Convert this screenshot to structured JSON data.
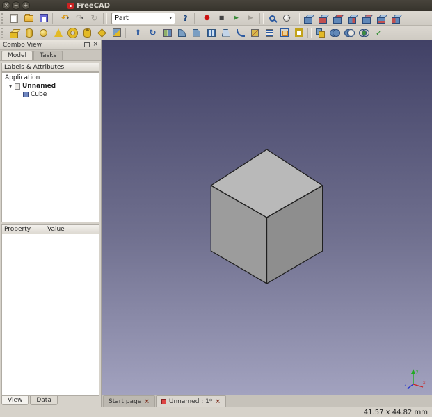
{
  "window": {
    "title": "FreeCAD",
    "buttons": {
      "close": "×",
      "minimize": "−",
      "maximize": "+"
    }
  },
  "ui_glyphs": {
    "caret": "▾",
    "expander": "▼",
    "close": "×"
  },
  "toolbars": {
    "workbench_selector": {
      "value": "Part"
    },
    "file_icons": [
      {
        "name": "new-document-icon",
        "cls": "i-doc"
      },
      {
        "name": "open-document-icon",
        "cls": "i-folder"
      },
      {
        "name": "save-document-icon",
        "cls": "i-save"
      },
      {
        "type": "sep"
      },
      {
        "name": "undo-icon",
        "cls": "i-undo",
        "glyph": "↶",
        "caret": true
      },
      {
        "name": "redo-icon",
        "cls": "i-redo",
        "glyph": "↷",
        "caret": true
      },
      {
        "name": "refresh-icon",
        "cls": "i-refresh",
        "glyph": "↻"
      },
      {
        "type": "sep"
      }
    ],
    "view_icons": [
      {
        "name": "whats-this-icon",
        "cls": "i-whatsthis",
        "glyph": "?"
      },
      {
        "type": "sep"
      },
      {
        "name": "macro-record-icon",
        "cls": "i-record",
        "glyph": "●"
      },
      {
        "name": "macro-stop-icon",
        "cls": "i-stop",
        "glyph": "■"
      },
      {
        "name": "macro-play-icon",
        "cls": "i-play",
        "glyph": "▶"
      },
      {
        "name": "macro-step-icon",
        "cls": "i-step",
        "glyph": "▶"
      },
      {
        "type": "sep"
      },
      {
        "name": "fit-all-icon",
        "cls": "i-mag"
      },
      {
        "name": "draw-style-icon",
        "cls": "i-drawstyle",
        "caret": true
      },
      {
        "type": "sep"
      },
      {
        "name": "view-axonometric-icon",
        "cls": "i-cube"
      },
      {
        "name": "view-front-icon",
        "cls": "i-cube c-front"
      },
      {
        "name": "view-top-icon",
        "cls": "i-cube c-top"
      },
      {
        "name": "view-right-icon",
        "cls": "i-cube c-right"
      },
      {
        "name": "view-rear-icon",
        "cls": "i-cube c-rear"
      },
      {
        "name": "view-bottom-icon",
        "cls": "i-cube c-bottom"
      },
      {
        "name": "view-left-icon",
        "cls": "i-cube c-left"
      }
    ],
    "part_icons": [
      {
        "name": "part-box-icon",
        "cls": "i-ybox"
      },
      {
        "name": "part-cylinder-icon",
        "cls": "i-ycyl"
      },
      {
        "name": "part-sphere-icon",
        "cls": "i-ysph"
      },
      {
        "name": "part-cone-icon",
        "cls": "i-ycone"
      },
      {
        "name": "part-torus-icon",
        "cls": "i-ytorus"
      },
      {
        "name": "part-tube-icon",
        "cls": "i-ytube"
      },
      {
        "name": "part-create-primitives-icon",
        "cls": "i-yprim"
      },
      {
        "name": "part-shape-builder-icon",
        "cls": "i-shapebuild"
      },
      {
        "type": "sep"
      },
      {
        "name": "part-extrude-icon",
        "cls": "i-extrude",
        "glyph": "⇑"
      },
      {
        "name": "part-revolve-icon",
        "cls": "i-revolve",
        "glyph": "↻"
      },
      {
        "name": "part-mirror-icon",
        "cls": "i-mirror"
      },
      {
        "name": "part-fillet-icon",
        "cls": "i-fillet"
      },
      {
        "name": "part-chamfer-icon",
        "cls": "i-chamfer"
      },
      {
        "name": "part-ruled-surface-icon",
        "cls": "i-ruled"
      },
      {
        "name": "part-loft-icon",
        "cls": "i-loft"
      },
      {
        "name": "part-sweep-icon",
        "cls": "i-sweep"
      },
      {
        "name": "part-section-icon",
        "cls": "i-section"
      },
      {
        "name": "part-cross-sections-icon",
        "cls": "i-xsection"
      },
      {
        "name": "part-offset-icon",
        "cls": "i-offset"
      },
      {
        "name": "part-thickness-icon",
        "cls": "i-thickness"
      },
      {
        "type": "sep"
      },
      {
        "name": "part-compound-icon",
        "cls": "i-compound"
      },
      {
        "name": "part-boolean-union-icon",
        "cls": "i-union"
      },
      {
        "name": "part-boolean-cut-icon",
        "cls": "i-cut"
      },
      {
        "name": "part-boolean-intersection-icon",
        "cls": "i-intersect"
      },
      {
        "name": "part-check-geometry-icon",
        "cls": "i-checkgeo",
        "glyph": "✓"
      }
    ]
  },
  "combo_view": {
    "title": "Combo View",
    "tabs": [
      {
        "label": "Model",
        "active": true
      },
      {
        "label": "Tasks",
        "active": false
      }
    ],
    "tree_header": "Labels & Attributes",
    "tree": [
      {
        "label": "Application",
        "level": 0
      },
      {
        "label": "Unnamed",
        "level": 1,
        "bold": true,
        "expanded": true
      },
      {
        "label": "Cube",
        "level": 2
      }
    ],
    "property_table": {
      "headers": [
        "Property",
        "Value"
      ],
      "rows": []
    },
    "bottom_tabs": [
      {
        "label": "View",
        "active": true
      },
      {
        "label": "Data",
        "active": false
      }
    ]
  },
  "document_tabs": [
    {
      "label": "Start page",
      "active": false
    },
    {
      "label": "Unnamed : 1*",
      "active": true
    }
  ],
  "viewport": {
    "background_top": "#414166",
    "background_mid": "#70708f",
    "background_bottom": "#a2a2bf",
    "cube": {
      "top_face": "#b9b9b9",
      "left_face": "#9c9c9c",
      "right_face": "#8e8e8e",
      "edge": "#1f1f1f"
    },
    "axis_indicator": {
      "x_color": "#cc2222",
      "y_color": "#22aa22",
      "z_color": "#2233cc",
      "labels": [
        "x",
        "y",
        "z"
      ]
    }
  },
  "status_bar": {
    "dimension_readout": "41.57 x 44.82 mm"
  }
}
